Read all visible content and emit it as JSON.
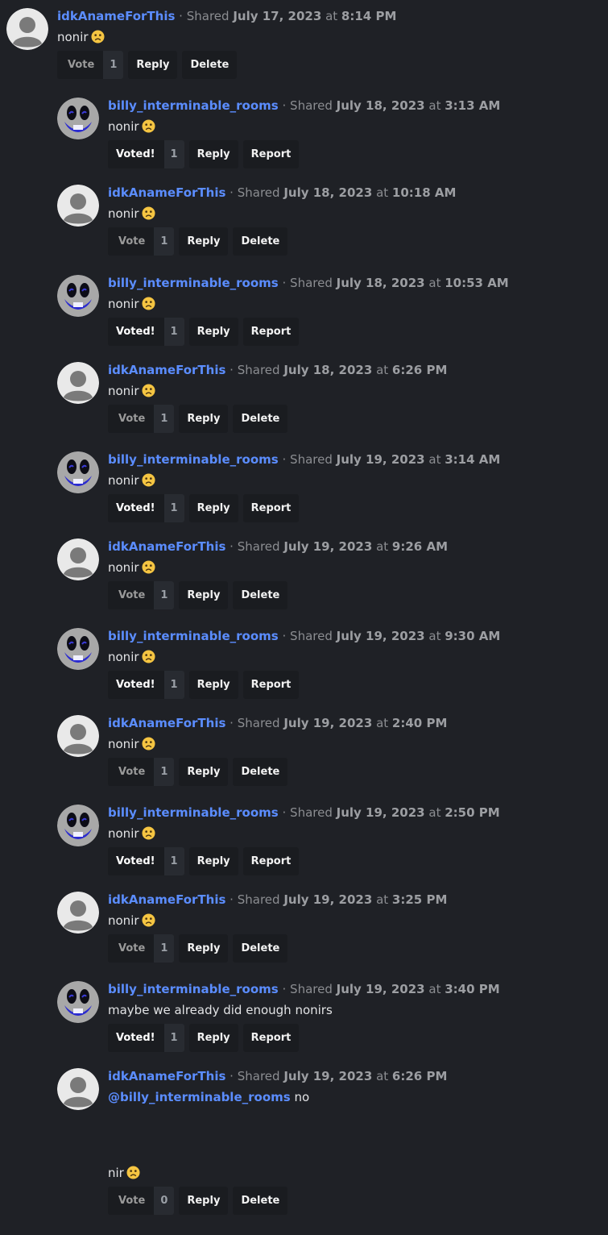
{
  "ui": {
    "separator": "·",
    "shared_prefix": "Shared",
    "at_word": "at",
    "emoji_icon": "frowning-face-emoji"
  },
  "comments": [
    {
      "author": "idkAnameForThis",
      "date": "July 17, 2023",
      "time": "8:14 PM",
      "text": "nonir",
      "emoji": true,
      "vote_label": "Vote",
      "voted": false,
      "count": "1",
      "reply_label": "Reply",
      "action_label": "Delete",
      "avatar": "default"
    },
    {
      "author": "billy_interminable_rooms",
      "date": "July 18, 2023",
      "time": "3:13 AM",
      "text": "nonir",
      "emoji": true,
      "vote_label": "Voted!",
      "voted": true,
      "count": "1",
      "reply_label": "Reply",
      "action_label": "Report",
      "avatar": "smiley"
    },
    {
      "author": "idkAnameForThis",
      "date": "July 18, 2023",
      "time": "10:18 AM",
      "text": "nonir",
      "emoji": true,
      "vote_label": "Vote",
      "voted": false,
      "count": "1",
      "reply_label": "Reply",
      "action_label": "Delete",
      "avatar": "default"
    },
    {
      "author": "billy_interminable_rooms",
      "date": "July 18, 2023",
      "time": "10:53 AM",
      "text": "nonir",
      "emoji": true,
      "vote_label": "Voted!",
      "voted": true,
      "count": "1",
      "reply_label": "Reply",
      "action_label": "Report",
      "avatar": "smiley"
    },
    {
      "author": "idkAnameForThis",
      "date": "July 18, 2023",
      "time": "6:26 PM",
      "text": "nonir",
      "emoji": true,
      "vote_label": "Vote",
      "voted": false,
      "count": "1",
      "reply_label": "Reply",
      "action_label": "Delete",
      "avatar": "default"
    },
    {
      "author": "billy_interminable_rooms",
      "date": "July 19, 2023",
      "time": "3:14 AM",
      "text": "nonir",
      "emoji": true,
      "vote_label": "Voted!",
      "voted": true,
      "count": "1",
      "reply_label": "Reply",
      "action_label": "Report",
      "avatar": "smiley"
    },
    {
      "author": "idkAnameForThis",
      "date": "July 19, 2023",
      "time": "9:26 AM",
      "text": "nonir",
      "emoji": true,
      "vote_label": "Vote",
      "voted": false,
      "count": "1",
      "reply_label": "Reply",
      "action_label": "Delete",
      "avatar": "default"
    },
    {
      "author": "billy_interminable_rooms",
      "date": "July 19, 2023",
      "time": "9:30 AM",
      "text": "nonir",
      "emoji": true,
      "vote_label": "Voted!",
      "voted": true,
      "count": "1",
      "reply_label": "Reply",
      "action_label": "Report",
      "avatar": "smiley"
    },
    {
      "author": "idkAnameForThis",
      "date": "July 19, 2023",
      "time": "2:40 PM",
      "text": "nonir",
      "emoji": true,
      "vote_label": "Vote",
      "voted": false,
      "count": "1",
      "reply_label": "Reply",
      "action_label": "Delete",
      "avatar": "default"
    },
    {
      "author": "billy_interminable_rooms",
      "date": "July 19, 2023",
      "time": "2:50 PM",
      "text": "nonir",
      "emoji": true,
      "vote_label": "Voted!",
      "voted": true,
      "count": "1",
      "reply_label": "Reply",
      "action_label": "Report",
      "avatar": "smiley"
    },
    {
      "author": "idkAnameForThis",
      "date": "July 19, 2023",
      "time": "3:25 PM",
      "text": "nonir",
      "emoji": true,
      "vote_label": "Vote",
      "voted": false,
      "count": "1",
      "reply_label": "Reply",
      "action_label": "Delete",
      "avatar": "default"
    },
    {
      "author": "billy_interminable_rooms",
      "date": "July 19, 2023",
      "time": "3:40 PM",
      "text": "maybe we already did enough nonirs",
      "emoji": false,
      "vote_label": "Voted!",
      "voted": true,
      "count": "1",
      "reply_label": "Reply",
      "action_label": "Report",
      "avatar": "smiley"
    },
    {
      "author": "idkAnameForThis",
      "date": "July 19, 2023",
      "time": "6:26 PM",
      "mention": "@billy_interminable_rooms",
      "text": "no",
      "text2": "nir",
      "emoji": false,
      "emoji2": true,
      "vote_label": "Vote",
      "voted": false,
      "count": "0",
      "reply_label": "Reply",
      "action_label": "Delete",
      "avatar": "default"
    }
  ]
}
